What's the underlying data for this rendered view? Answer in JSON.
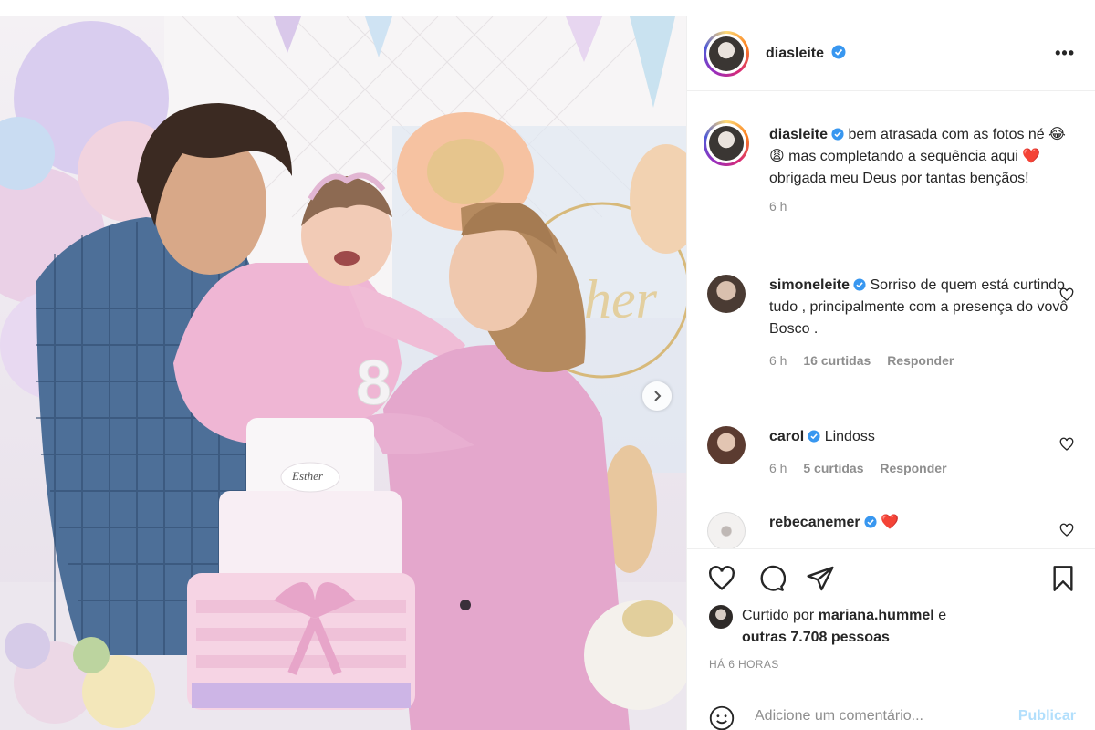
{
  "post": {
    "author": "diasleite",
    "verified": true,
    "more_label": "•••",
    "caption": {
      "username": "diasleite",
      "text_part1": " bem atrasada com as fotos né ",
      "emoji1": "😂",
      "emoji2": "😩",
      "text_part2": " mas completando a sequência aqui ",
      "emoji3": "❤️",
      "text_part3": " obrigada meu Deus por tantas bençãos!",
      "time": "6 h"
    },
    "comments": [
      {
        "username": "simoneleite",
        "text": " Sorriso de quem está curtindo tudo , principalmente com a presença do vovô Bosco .",
        "time": "6 h",
        "likes": "16 curtidas",
        "reply": "Responder"
      },
      {
        "username": "carol",
        "text": " Lindoss",
        "time": "6 h",
        "likes": "5 curtidas",
        "reply": "Responder"
      },
      {
        "username": "rebecanemer",
        "text": " ❤️"
      }
    ],
    "liked_by": {
      "prefix": "Curtido por ",
      "user": "mariana.hummel",
      "middle": " e",
      "others": "outras 7.708 pessoas"
    },
    "timestamp": "HÁ 6 HORAS",
    "add_comment": {
      "placeholder": "Adicione um comentário...",
      "post_label": "Publicar"
    },
    "photo": {
      "cake_name": "Esther"
    }
  },
  "colors": {
    "verified_blue": "#3897f0",
    "publish_disabled": "#b2dffc",
    "heart_red": "#ed4956"
  }
}
